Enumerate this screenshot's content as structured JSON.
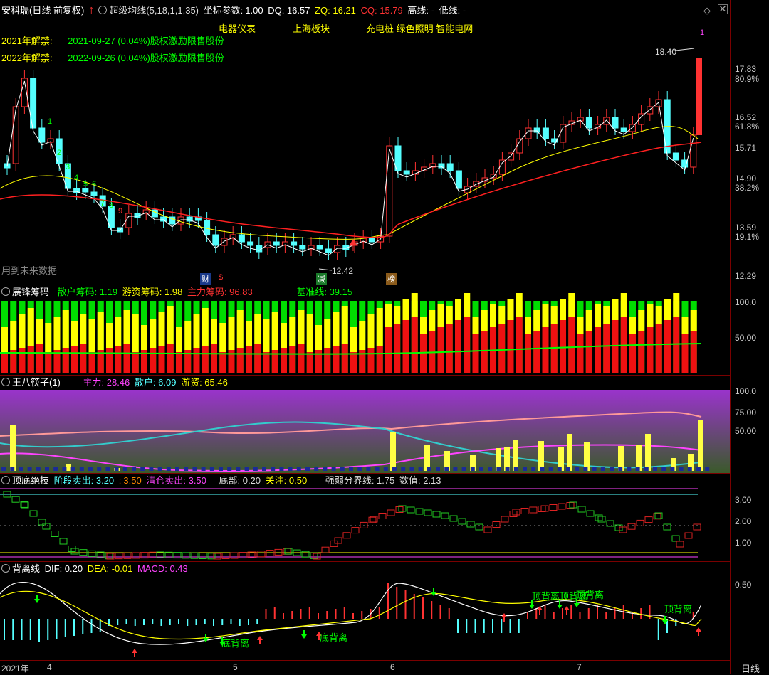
{
  "main_header": {
    "title": "安科瑞(日线 前复权)",
    "indicator": "超级均线(5,18,1,1,35)",
    "coord_label": "坐标参数:",
    "coord_value": "1.00",
    "dq": "DQ: 16.57",
    "zq": "ZQ: 16.21",
    "cq": "CQ: 15.79",
    "gao": "高线: -",
    "di": "低线: -"
  },
  "sectors": [
    "电器仪表",
    "上海板块",
    "充电桩 绿色照明 智能电网"
  ],
  "unlock": [
    {
      "label": "2021年解禁:",
      "text": "2021-09-27 (0.04%)股权激励限售股份"
    },
    {
      "label": "2022年解禁:",
      "text": "2022-09-26 (0.04%)股权激励限售股份"
    }
  ],
  "future_note": "用到未来数据",
  "price_marks": {
    "high": "18.40",
    "low": "12.42",
    "top_num": "1"
  },
  "event_tags": {
    "cai": "财",
    "s": "$",
    "jian": "减",
    "bang": "榜"
  },
  "seq_labels": [
    "1",
    "2",
    "3",
    "4",
    "5",
    "6",
    "7",
    "8",
    "9"
  ],
  "main_y": [
    "17.83",
    "80.9%",
    "16.52",
    "61.8%",
    "15.71",
    "14.90",
    "38.2%",
    "13.59",
    "19.1%",
    "12.29"
  ],
  "chip_header": {
    "name": "展锋筹码",
    "sanhu": "散户筹码: 1.19",
    "youzi": "游资筹码: 1.98",
    "zhuli": "主力筹码: 96.83",
    "jizhun": "基准线: 39.15"
  },
  "chip_y": [
    "100.0",
    "50.00"
  ],
  "wb_header": {
    "name": "王八筷子(1)",
    "zhuli": "主力: 28.46",
    "sanhu": "散户: 6.09",
    "youzi": "游资: 65.46"
  },
  "wb_y": [
    "100.0",
    "75.00",
    "50.00"
  ],
  "top_header": {
    "name": "顶底绝技",
    "jd": "阶段卖出: 3.20",
    "jd2": "3.50",
    "qc": "清仓卖出: 3.50",
    "db": "底部: 0.20",
    "gz": "关注: 0.50",
    "qr": "强弱分界线: 1.75",
    "sz": "数值: 2.13"
  },
  "top_y": [
    "3.00",
    "2.00",
    "1.00"
  ],
  "macd_header": {
    "name": "背离线",
    "dif": "DIF: 0.20",
    "dea": "DEA: -0.01",
    "macd": "MACD: 0.43"
  },
  "macd_y": [
    "0.50"
  ],
  "macd_tags": {
    "bottom1": "底背离",
    "bottom2": "底背离",
    "top1": "顶背离",
    "top2": "顶背离",
    "top3": "顶背离",
    "top4": "顶背离"
  },
  "x_labels": [
    "2021年",
    "4",
    "5",
    "6",
    "7"
  ],
  "period_button": "日线",
  "colors": {
    "up": "#ff3232",
    "down": "#54ffff",
    "yellow": "#ffff00",
    "green": "#00ff00",
    "magenta": "#ff44ff"
  }
}
